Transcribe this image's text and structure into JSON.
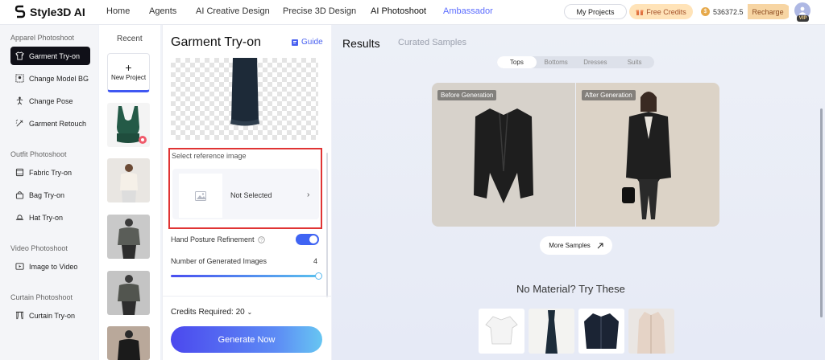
{
  "brand": {
    "name": "Style3D AI"
  },
  "nav": {
    "items": [
      "Home",
      "Agents",
      "AI Creative Design",
      "Precise 3D Design",
      "AI Photoshoot",
      "Ambassador"
    ]
  },
  "header": {
    "my_projects": "My Projects",
    "free_credits": "Free Credits",
    "balance": "536372.5",
    "recharge": "Recharge",
    "vip": "VIP"
  },
  "sidebar": {
    "sections": [
      {
        "title": "Apparel Photoshoot",
        "items": [
          "Garment Try-on",
          "Change Model BG",
          "Change Pose",
          "Garment Retouch"
        ]
      },
      {
        "title": "Outfit Photoshoot",
        "items": [
          "Fabric Try-on",
          "Bag Try-on",
          "Hat Try-on"
        ]
      },
      {
        "title": "Video Photoshoot",
        "items": [
          "Image to Video"
        ]
      },
      {
        "title": "Curtain Photoshoot",
        "items": [
          "Curtain Try-on"
        ]
      }
    ]
  },
  "recent": {
    "label": "Recent",
    "new_project": "New Project"
  },
  "panel": {
    "title": "Garment Try-on",
    "guide": "Guide",
    "ref_label": "Select reference image",
    "ref_status": "Not Selected",
    "hand_posture": "Hand Posture Refinement",
    "num_images_label": "Number of Generated Images",
    "num_images_value": "4",
    "num_images_fraction": 1.0,
    "credits_required": "Credits Required: 20",
    "generate": "Generate Now"
  },
  "results": {
    "title": "Results",
    "curated": "Curated Samples",
    "tabs": [
      "Tops",
      "Bottoms",
      "Dresses",
      "Suits"
    ],
    "before_tag": "Before Generation",
    "after_tag": "After Generation",
    "more_samples": "More Samples",
    "no_material": "No Material? Try These"
  },
  "colors": {
    "accent": "#3f57f2",
    "highlight": "#e03434"
  }
}
